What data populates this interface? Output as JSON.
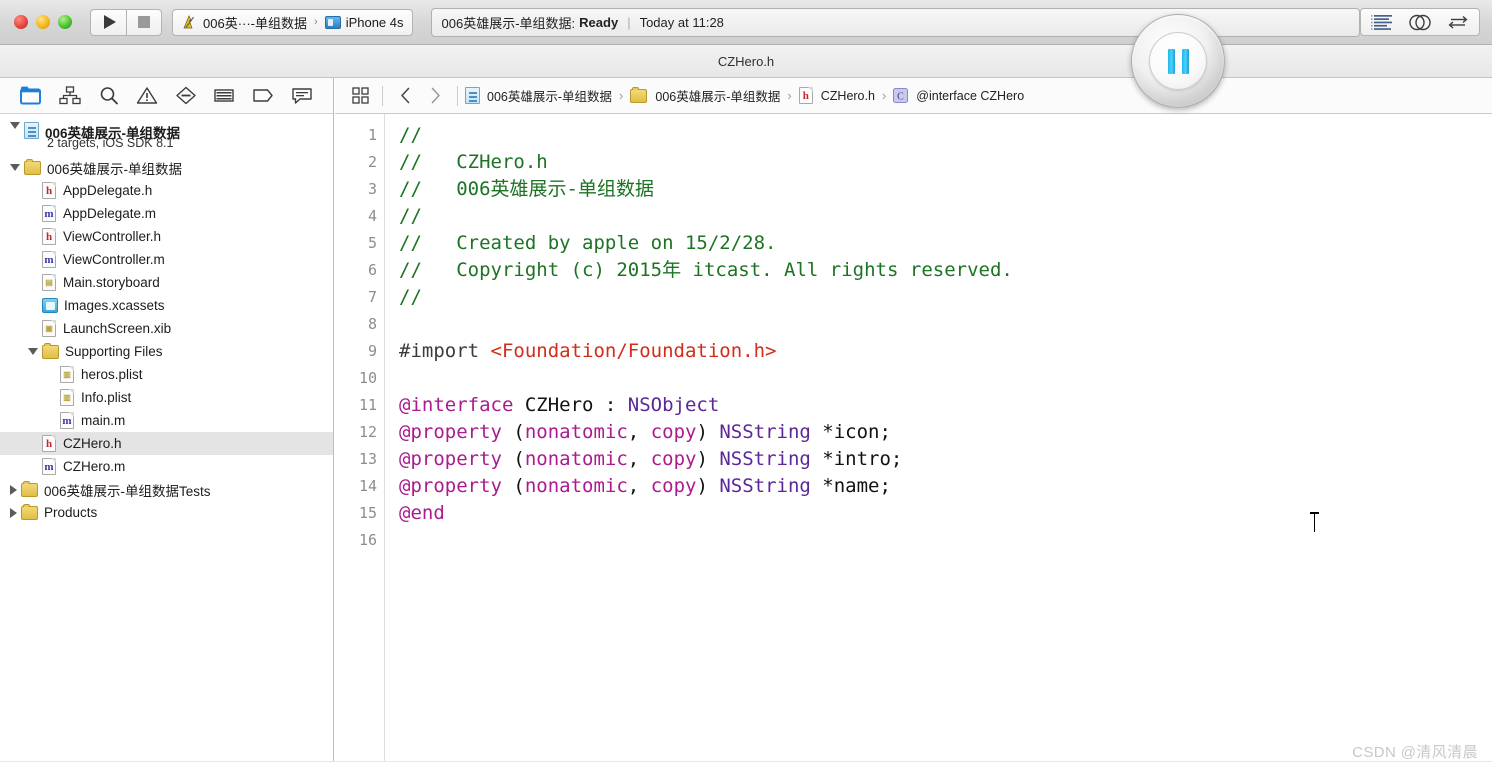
{
  "toolbar": {
    "window_controls": [
      "close",
      "minimize",
      "zoom"
    ],
    "run_button_label": "Run",
    "stop_button_label": "Stop",
    "scheme": {
      "project_icon": "xcode-logo-icon",
      "scheme_name": "006英···-单组数据",
      "separator": "›",
      "destination_icon": "iphone-simulator-icon",
      "destination_name": "iPhone 4s"
    },
    "status": {
      "project": "006英雄展示-单组数据:",
      "state": "Ready",
      "separator": "|",
      "time": "Today at 11:28"
    },
    "editor_buttons": [
      {
        "name": "standard-editor",
        "label": "Standard Editor"
      },
      {
        "name": "assistant-editor",
        "label": "Assistant Editor"
      },
      {
        "name": "version-editor",
        "label": "Version Editor"
      }
    ]
  },
  "tabbar": {
    "active_tab": "CZHero.h"
  },
  "navigator": {
    "toolbar_icons": [
      {
        "name": "project-navigator-icon",
        "label": "Project Navigator",
        "active": true
      },
      {
        "name": "symbol-navigator-icon",
        "label": "Symbol Navigator",
        "active": false
      },
      {
        "name": "find-navigator-icon",
        "label": "Find Navigator",
        "active": false
      },
      {
        "name": "issue-navigator-icon",
        "label": "Issue Navigator",
        "active": false
      },
      {
        "name": "test-navigator-icon",
        "label": "Test Navigator",
        "active": false
      },
      {
        "name": "debug-navigator-icon",
        "label": "Debug Navigator",
        "active": false
      },
      {
        "name": "breakpoint-navigator-icon",
        "label": "Breakpoint Navigator",
        "active": false
      },
      {
        "name": "report-navigator-icon",
        "label": "Report Navigator",
        "active": false
      }
    ],
    "project": {
      "name": "006英雄展示-单组数据",
      "subtitle": "2 targets, iOS SDK 8.1"
    },
    "items": [
      {
        "label": "006英雄展示-单组数据",
        "icon": "folder-icon",
        "indent": 1,
        "twisty": "open",
        "selected": false
      },
      {
        "label": "AppDelegate.h",
        "icon": "h-file-icon",
        "indent": 2,
        "twisty": "none",
        "selected": false
      },
      {
        "label": "AppDelegate.m",
        "icon": "m-file-icon",
        "indent": 2,
        "twisty": "none",
        "selected": false
      },
      {
        "label": "ViewController.h",
        "icon": "h-file-icon",
        "indent": 2,
        "twisty": "none",
        "selected": false
      },
      {
        "label": "ViewController.m",
        "icon": "m-file-icon",
        "indent": 2,
        "twisty": "none",
        "selected": false
      },
      {
        "label": "Main.storyboard",
        "icon": "storyboard-icon",
        "indent": 2,
        "twisty": "none",
        "selected": false
      },
      {
        "label": "Images.xcassets",
        "icon": "xcassets-icon",
        "indent": 2,
        "twisty": "none",
        "selected": false
      },
      {
        "label": "LaunchScreen.xib",
        "icon": "xib-icon",
        "indent": 2,
        "twisty": "none",
        "selected": false
      },
      {
        "label": "Supporting Files",
        "icon": "folder-icon",
        "indent": 2,
        "twisty": "open",
        "selected": false
      },
      {
        "label": "heros.plist",
        "icon": "plist-icon",
        "indent": 3,
        "twisty": "none",
        "selected": false
      },
      {
        "label": "Info.plist",
        "icon": "plist-icon",
        "indent": 3,
        "twisty": "none",
        "selected": false
      },
      {
        "label": "main.m",
        "icon": "m-file-icon",
        "indent": 3,
        "twisty": "none",
        "selected": false
      },
      {
        "label": "CZHero.h",
        "icon": "h-file-icon",
        "indent": 2,
        "twisty": "none",
        "selected": true
      },
      {
        "label": "CZHero.m",
        "icon": "m-file-icon",
        "indent": 2,
        "twisty": "none",
        "selected": false
      },
      {
        "label": "006英雄展示-单组数据Tests",
        "icon": "folder-icon",
        "indent": 1,
        "twisty": "closed",
        "selected": false
      },
      {
        "label": "Products",
        "icon": "folder-icon",
        "indent": 1,
        "twisty": "closed",
        "selected": false
      }
    ]
  },
  "editor": {
    "jumpbar": {
      "related_items_icon": "related-items-icon",
      "back_icon": "chevron-left-icon",
      "forward_icon": "chevron-right-icon",
      "crumbs": [
        {
          "icon": "project-file-icon",
          "label": "006英雄展示-单组数据"
        },
        {
          "icon": "folder-icon",
          "label": "006英雄展示-单组数据"
        },
        {
          "icon": "h-file-icon",
          "label": "CZHero.h"
        },
        {
          "icon": "interface-icon",
          "label": "@interface CZHero"
        }
      ],
      "separator": "›"
    },
    "line_count": 16,
    "line_numbers": [
      "1",
      "2",
      "3",
      "4",
      "5",
      "6",
      "7",
      "8",
      "9",
      "10",
      "11",
      "12",
      "13",
      "14",
      "15",
      "16"
    ],
    "lines": [
      [
        {
          "t": "//",
          "c": "comment"
        }
      ],
      [
        {
          "t": "//   CZHero.h",
          "c": "comment"
        }
      ],
      [
        {
          "t": "//   006英雄展示-单组数据",
          "c": "comment"
        }
      ],
      [
        {
          "t": "//",
          "c": "comment"
        }
      ],
      [
        {
          "t": "//   Created by apple on 15/2/28.",
          "c": "comment"
        }
      ],
      [
        {
          "t": "//   Copyright (c) 2015年 itcast. All rights reserved.",
          "c": "comment"
        }
      ],
      [
        {
          "t": "//",
          "c": "comment"
        }
      ],
      [
        {
          "t": "",
          "c": "plain"
        }
      ],
      [
        {
          "t": "#import ",
          "c": "pre"
        },
        {
          "t": "<Foundation/Foundation.h>",
          "c": "str"
        }
      ],
      [
        {
          "t": "",
          "c": "plain"
        }
      ],
      [
        {
          "t": "@interface",
          "c": "kw"
        },
        {
          "t": " CZHero : ",
          "c": "plain"
        },
        {
          "t": "NSObject",
          "c": "type"
        }
      ],
      [
        {
          "t": "@property",
          "c": "kw"
        },
        {
          "t": " (",
          "c": "plain"
        },
        {
          "t": "nonatomic",
          "c": "kw"
        },
        {
          "t": ", ",
          "c": "plain"
        },
        {
          "t": "copy",
          "c": "kw"
        },
        {
          "t": ") ",
          "c": "plain"
        },
        {
          "t": "NSString",
          "c": "type"
        },
        {
          "t": " *icon;",
          "c": "plain"
        }
      ],
      [
        {
          "t": "@property",
          "c": "kw"
        },
        {
          "t": " (",
          "c": "plain"
        },
        {
          "t": "nonatomic",
          "c": "kw"
        },
        {
          "t": ", ",
          "c": "plain"
        },
        {
          "t": "copy",
          "c": "kw"
        },
        {
          "t": ") ",
          "c": "plain"
        },
        {
          "t": "NSString",
          "c": "type"
        },
        {
          "t": " *intro;",
          "c": "plain"
        }
      ],
      [
        {
          "t": "@property",
          "c": "kw"
        },
        {
          "t": " (",
          "c": "plain"
        },
        {
          "t": "nonatomic",
          "c": "kw"
        },
        {
          "t": ", ",
          "c": "plain"
        },
        {
          "t": "copy",
          "c": "kw"
        },
        {
          "t": ") ",
          "c": "plain"
        },
        {
          "t": "NSString",
          "c": "type"
        },
        {
          "t": " *name;",
          "c": "plain"
        }
      ],
      [
        {
          "t": "@end",
          "c": "kw"
        }
      ],
      [
        {
          "t": "",
          "c": "plain"
        }
      ]
    ],
    "colors": {
      "comment": "#1d7324",
      "preprocessor": "#3b3b3b",
      "string": "#d32c18",
      "keyword": "#ab1a8e",
      "type": "#5c2699",
      "plain": "#111111",
      "background": "#ffffff"
    }
  },
  "overlay": {
    "pause_button": "pause-recording-button",
    "pause_glyph": "II"
  },
  "watermark": {
    "text": "CSDN @清风清晨"
  }
}
